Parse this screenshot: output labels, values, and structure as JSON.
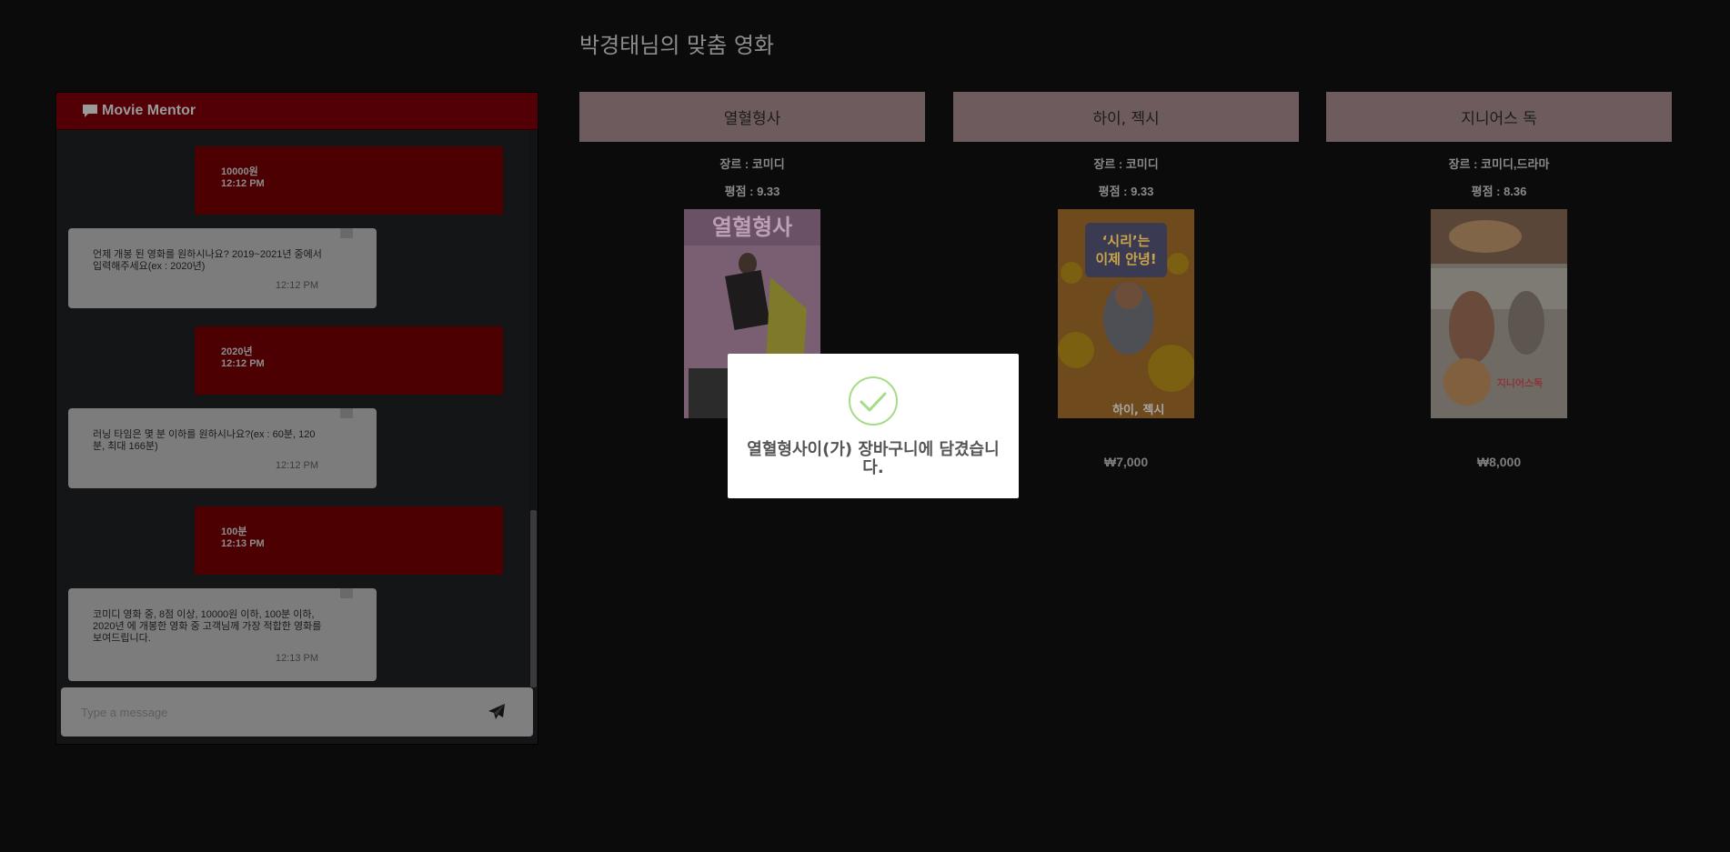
{
  "page": {
    "title": "박경태님의 맞춤 영화"
  },
  "chat": {
    "title": "Movie Mentor",
    "header_icon": "comment-icon",
    "messages": [
      {
        "from": "user",
        "text": "10000원",
        "time": "12:12 PM"
      },
      {
        "from": "bot",
        "text": "언제 개봉 된 영화를 원하시나요? 2019~2021년 중에서 입력해주세요(ex : 2020년)",
        "time": "12:12 PM"
      },
      {
        "from": "user",
        "text": "2020년",
        "time": "12:12 PM"
      },
      {
        "from": "bot",
        "text": "러닝 타임은 몇 분 이하를 원하시나요?(ex : 60분, 120분, 최대 166분)",
        "time": "12:12 PM"
      },
      {
        "from": "user",
        "text": "100분",
        "time": "12:13 PM"
      },
      {
        "from": "bot",
        "text": "코미디 영화 중, 8점 이상, 10000원 이하, 100분 이하, 2020년 에 개봉한 영화 중 고객님께 가장 적합한 영화를 보여드립니다.",
        "time": "12:13 PM"
      }
    ],
    "input_placeholder": "Type a message",
    "send_icon": "paper-plane-icon"
  },
  "movies": [
    {
      "title": "열혈형사",
      "genre": "장르 : 코미디",
      "rating": "평점 : 9.33",
      "price": "₩",
      "poster_colors": [
        "#c79ab8",
        "#e6e04a"
      ]
    },
    {
      "title": "하이, 젝시",
      "genre": "장르 : 코미디",
      "rating": "평점 : 9.33",
      "price": "₩7,000",
      "poster_colors": [
        "#e07a26",
        "#f2c21f"
      ]
    },
    {
      "title": "지니어스 독",
      "genre": "장르 : 코미디,드라마",
      "rating": "평점 : 8.36",
      "price": "₩8,000",
      "poster_colors": [
        "#b58a6a",
        "#f0e6d6"
      ]
    }
  ],
  "toast": {
    "message": "열혈형사이(가) 장바구니에 담겼습니다.",
    "icon": "check-circle-icon",
    "icon_color": "#a5dc86"
  },
  "colors": {
    "accent": "#520006",
    "overlay_bg": "#0b0b0c"
  }
}
